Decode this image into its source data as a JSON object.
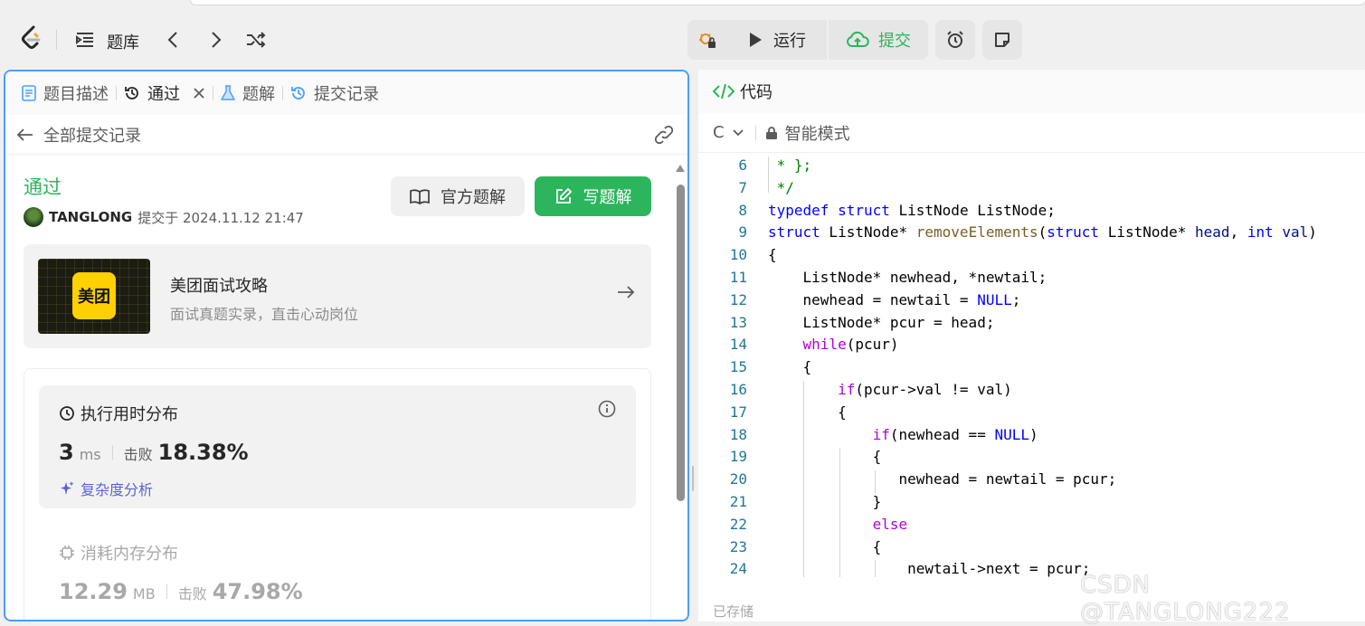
{
  "topbar": {
    "problem_bank_label": "题库",
    "run_label": "运行",
    "submit_label": "提交"
  },
  "tabs": [
    {
      "label": "题目描述"
    },
    {
      "label": "通过"
    },
    {
      "label": "题解"
    },
    {
      "label": "提交记录"
    }
  ],
  "subheader": {
    "title": "全部提交记录"
  },
  "submission": {
    "status": "通过",
    "author": "TANGLONG",
    "submitted_at": "提交于 2024.11.12 21:47",
    "official_solution_label": "官方题解",
    "write_solution_label": "写题解"
  },
  "promo": {
    "logo_text": "美团",
    "title": "美团面试攻略",
    "subtitle": "面试真题实录，直击心动岗位"
  },
  "runtime": {
    "title": "执行用时分布",
    "value": "3",
    "unit": "ms",
    "beat_label": "击败",
    "beat_value": "18.38%",
    "complexity_label": "复杂度分析"
  },
  "memory": {
    "title": "消耗内存分布",
    "value": "12.29",
    "unit": "MB",
    "beat_label": "击败",
    "beat_value": "47.98%"
  },
  "editor": {
    "title": "代码",
    "language": "C",
    "mode": "智能模式",
    "saved_status": "已存储"
  },
  "watermark": "CSDN @TANGLONG222",
  "colors": {
    "accent_green": "#2db55d",
    "focus_blue": "#4a9eff",
    "complexity_purple": "#5b63d3"
  }
}
